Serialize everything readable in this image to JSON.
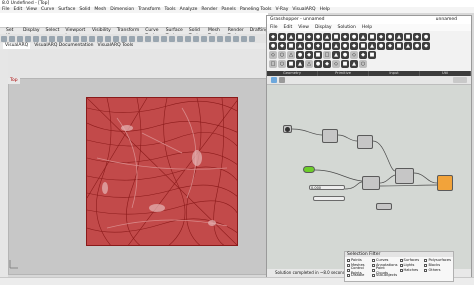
{
  "rhino": {
    "title": "8.0 Undefined - [Top]",
    "menus": [
      "File",
      "Edit",
      "View",
      "Curve",
      "Surface",
      "Solid",
      "Mesh",
      "Dimension",
      "Transform",
      "Tools",
      "Analyze",
      "Render",
      "Panels",
      "Paneling Tools",
      "V-Ray",
      "VisualARQ",
      "Help"
    ],
    "tabs_top": [
      "Set View",
      "Display",
      "Select",
      "Viewport Layout",
      "Visibility",
      "Transform",
      "Curve Tools",
      "Surface Tools",
      "Solid Tools",
      "Mesh Tools",
      "Render Tools",
      "Drafting"
    ],
    "tabs_bottom": [
      "VisualARQ",
      "VisualARQ Documentation",
      "VisualARQ Tools"
    ],
    "viewport_label": "Top"
  },
  "grasshopper": {
    "title": "Grasshopper - unnamed",
    "title_right": "unnamed",
    "menus": [
      "File",
      "Edit",
      "View",
      "Display",
      "Solution",
      "Help"
    ],
    "groups": [
      "Geometry",
      "Primitive",
      "Input",
      "Util"
    ],
    "status": "Solution completed in ~8.0 seconds (175 seconds ago)",
    "slider_value": "0.000"
  },
  "selection_filter": {
    "title": "Selection Filter",
    "items": [
      "Points",
      "Curves",
      "Surfaces",
      "Polysurfaces",
      "Meshes",
      "Annotations",
      "Lights",
      "Blocks",
      "Control Points",
      "Point Clouds",
      "Hatches",
      "Others",
      "Disable",
      "Sub-objects"
    ]
  },
  "colors": {
    "mesh": "#c24a4a",
    "node_orange": "#f2a33a",
    "node_green": "#6ccd2a"
  }
}
